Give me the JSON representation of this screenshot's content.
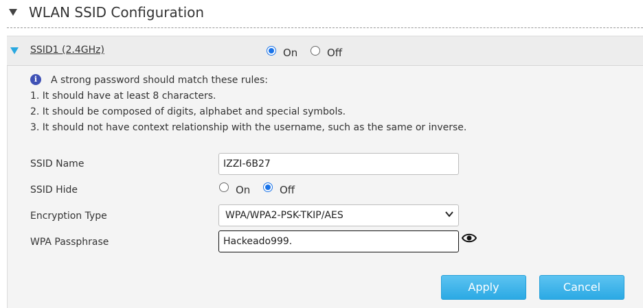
{
  "section": {
    "title": "WLAN SSID Configuration"
  },
  "ssid": {
    "name_link": "SSID1 (2.4GHz)",
    "enable": {
      "on_label": "On",
      "off_label": "Off",
      "selected": "On"
    }
  },
  "info": {
    "heading": "A strong password should match these rules:",
    "rules": [
      "1. It should have at least 8 characters.",
      "2. It should be composed of digits, alphabet and special symbols.",
      "3. It should not have context relationship with the username, such as the same or inverse."
    ]
  },
  "form": {
    "ssid_name_label": "SSID Name",
    "ssid_name_value": "IZZI-6B27",
    "ssid_hide_label": "SSID Hide",
    "ssid_hide": {
      "on_label": "On",
      "off_label": "Off",
      "selected": "Off"
    },
    "encryption_label": "Encryption Type",
    "encryption_value": "WPA/WPA2-PSK-TKIP/AES",
    "passphrase_label": "WPA Passphrase",
    "passphrase_value": "Hackeado999."
  },
  "buttons": {
    "apply": "Apply",
    "cancel": "Cancel"
  },
  "colors": {
    "accent": "#2ba9e4",
    "radio": "#1a73e8",
    "info_icon": "#3f51b5"
  }
}
